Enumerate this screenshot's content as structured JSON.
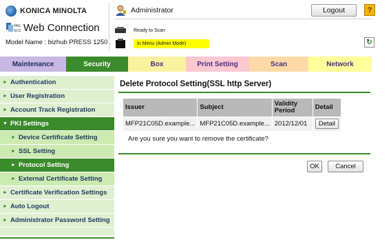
{
  "header": {
    "brand": "KONICA MINOLTA",
    "product": "Web Connection",
    "model_name": "Model Name : bizhub PRESS 1250",
    "user": "Administrator",
    "logout_label": "Logout",
    "help_label": "?",
    "status_ready": "Ready to Scan",
    "status_mode": "In Menu (Admin Mode)"
  },
  "tabs": [
    {
      "label": "Maintenance"
    },
    {
      "label": "Security"
    },
    {
      "label": "Box"
    },
    {
      "label": "Print Setting"
    },
    {
      "label": "Scan"
    },
    {
      "label": "Network"
    }
  ],
  "sidebar": {
    "items": [
      {
        "label": "Authentication"
      },
      {
        "label": "User Registration"
      },
      {
        "label": "Account Track Registration"
      },
      {
        "label": "PKI Settings"
      },
      {
        "label": "Device Certificate Setting"
      },
      {
        "label": "SSL Setting"
      },
      {
        "label": "Protocol Setting"
      },
      {
        "label": "External Certificate Setting"
      },
      {
        "label": "Certificate Verification Settings"
      },
      {
        "label": "Auto Logout"
      },
      {
        "label": "Administrator Password Setting"
      }
    ]
  },
  "main": {
    "title": "Delete Protocol Setting(SSL http Server)",
    "table": {
      "headers": [
        "Issuer",
        "Subject",
        "Validity Period",
        "Detail"
      ],
      "rows": [
        {
          "issuer": "MFP21C05D.example...",
          "subject": "MFP21C05D.example...",
          "validity": "2012/12/01",
          "detail_label": "Detail"
        }
      ]
    },
    "confirm_text": "Are you sure you want to remove the certificate?",
    "ok_label": "OK",
    "cancel_label": "Cancel"
  },
  "colors": {
    "accent_green": "#3b8a2b",
    "status_yellow": "#ffff00"
  }
}
